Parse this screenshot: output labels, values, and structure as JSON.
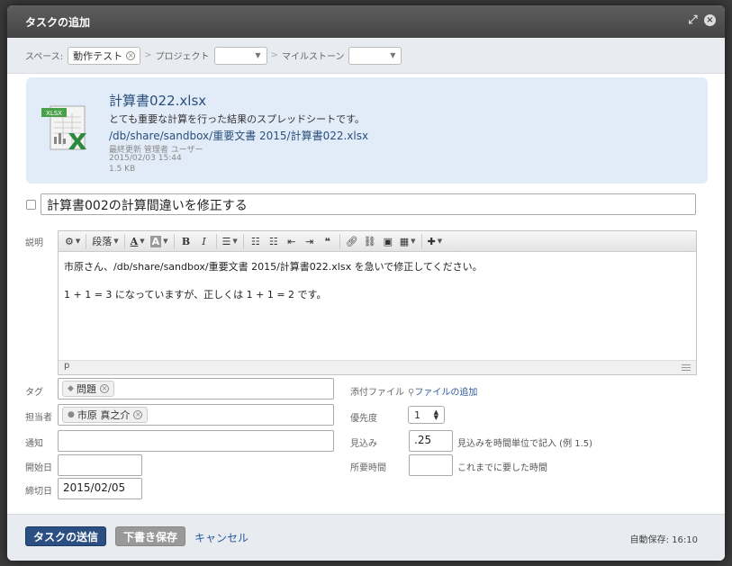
{
  "dialog": {
    "title": "タスクの追加"
  },
  "crumbs": {
    "space_label": "スペース:",
    "space_value": "動作テスト",
    "project_label": "プロジェクト",
    "milestone_label": "マイルストーン",
    "separator": ">"
  },
  "file": {
    "icon_label": "XLSX",
    "name": "計算書022.xlsx",
    "description": "とても重要な計算を行った結果のスプレッドシートです。",
    "path": "/db/share/sandbox/重要文書 2015/計算書022.xlsx",
    "updated_by": "最終更新 管理者 ユーザー",
    "updated_at": "2015/02/03 15:44",
    "size": "1.5 KB"
  },
  "task": {
    "title": "計算書002の計算間違いを修正する"
  },
  "description": {
    "label": "説明",
    "toolbar": {
      "paragraph_label": "段落"
    },
    "lines": [
      "市原さん、/db/share/sandbox/重要文書 2015/計算書022.xlsx を急いで修正してください。",
      "1 + 1 = 3 になっていますが、正しくは 1 + 1 = 2 です。"
    ],
    "status_path": "p"
  },
  "form": {
    "tag_label": "タグ",
    "tag_value": "問題",
    "assignee_label": "担当者",
    "assignee_value": "市原 真之介",
    "notify_label": "通知",
    "start_label": "開始日",
    "due_label": "締切日",
    "due_value": "2015/02/05",
    "attach_label": "添付ファイル",
    "attach_link": "ファイルの追加",
    "priority_label": "優先度",
    "priority_value": "1",
    "estimate_label": "見込み",
    "estimate_value": ".25",
    "estimate_hint": "見込みを時間単位で記入 (例 1.5)",
    "spent_label": "所要時間",
    "spent_hint": "これまでに要した時間"
  },
  "footer": {
    "submit_label": "タスクの送信",
    "draft_label": "下書き保存",
    "cancel_label": "キャンセル",
    "autosave": "自動保存: 16:10"
  },
  "colors": {
    "primary_button": "#2b4f82",
    "file_card_bg": "#e2ecf9",
    "link": "#2a5a9a"
  }
}
